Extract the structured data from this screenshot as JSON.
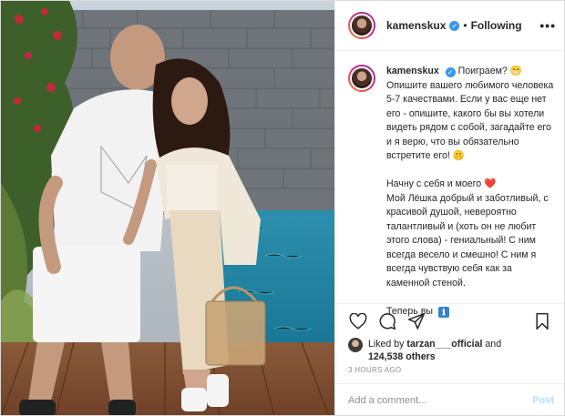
{
  "post": {
    "username": "kamenskux",
    "follow_status": "Following",
    "separator": "•",
    "more_label": "•••"
  },
  "caption": {
    "username": "kamenskux",
    "para1": "Поиграем? 😁 Опишите вашего любимого человека 5-7 качествами. Если у вас еще нет его - опишите, какого бы вы хотели видеть рядом с собой, загадайте его и я верю, что вы обязательно встретите его! 🤫",
    "para2_line1": "Начну с себя и моего ❤️",
    "para2_rest": "Мой Лёшка добрый и заботливый, с красивой душой, невероятно талантливый и (хоть он не любит этого слова) - гениальный! С ним всегда весело и смешно! С ним я всегда чувствую себя как за каменной стеной.",
    "para3": "Теперь вы",
    "para3_icon": "ℹ"
  },
  "icons": {
    "like": "heart-icon",
    "comment": "comment-icon",
    "share": "share-icon",
    "save": "bookmark-icon"
  },
  "likes": {
    "prefix": "Liked by",
    "user": "tarzan___official",
    "middle": "and",
    "count": "124,538 others"
  },
  "timestamp": "3 HOURS AGO",
  "add_comment": {
    "placeholder": "Add a comment...",
    "post_label": "Post"
  },
  "colors": {
    "verified": "#3897f0",
    "post_button_disabled": "#b2dffc",
    "heart_emoji": "#d9252f"
  }
}
